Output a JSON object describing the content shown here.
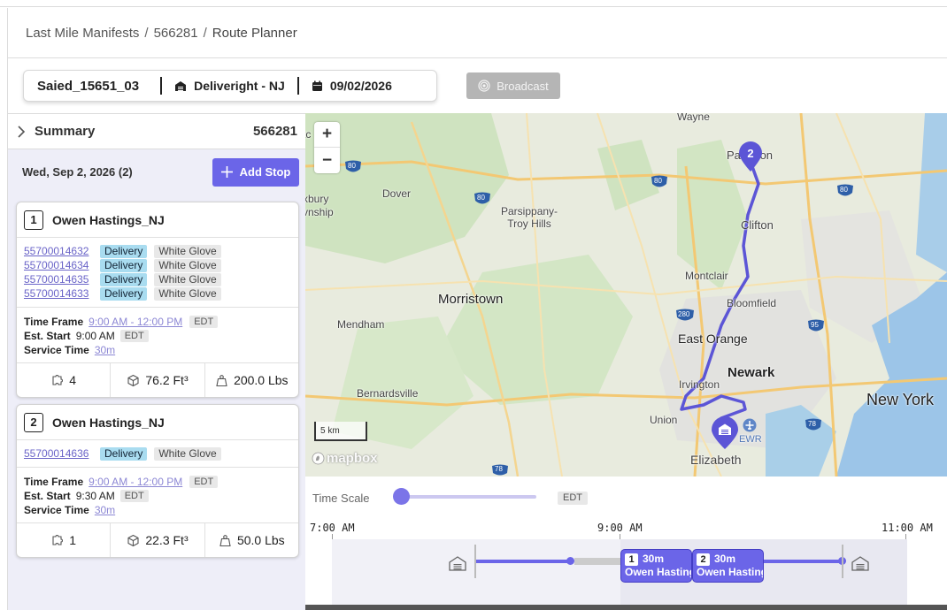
{
  "breadcrumb": {
    "items": [
      "Last Mile Manifests",
      "566281"
    ],
    "separator": "/",
    "current": "Route Planner"
  },
  "route_bar": {
    "route_name": "Saied_15651_03",
    "depot": "Deliveright - NJ",
    "date": "09/02/2026"
  },
  "broadcast_label": "Broadcast",
  "summary": {
    "label": "Summary",
    "value": "566281"
  },
  "day": {
    "date_label": "Wed, Sep 2, 2026 (2)",
    "add_stop_label": "Add Stop"
  },
  "labels": {
    "time_frame": "Time Frame",
    "est_start": "Est. Start",
    "service_time": "Service Time",
    "edt": "EDT"
  },
  "stops": [
    {
      "number": "1",
      "name": "Owen Hastings_NJ",
      "orders": [
        {
          "id": "55700014632",
          "type": "Delivery",
          "service": "White Glove"
        },
        {
          "id": "55700014634",
          "type": "Delivery",
          "service": "White Glove"
        },
        {
          "id": "55700014635",
          "type": "Delivery",
          "service": "White Glove"
        },
        {
          "id": "55700014633",
          "type": "Delivery",
          "service": "White Glove"
        }
      ],
      "time_frame": "9:00 AM - 12:00 PM",
      "est_start": "9:00 AM",
      "service_time": "30m",
      "pieces": "4",
      "volume": "76.2 Ft³",
      "weight": "200.0 Lbs"
    },
    {
      "number": "2",
      "name": "Owen Hastings_NJ",
      "orders": [
        {
          "id": "55700014636",
          "type": "Delivery",
          "service": "White Glove"
        }
      ],
      "time_frame": "9:00 AM - 12:00 PM",
      "est_start": "9:30 AM",
      "service_time": "30m",
      "pieces": "1",
      "volume": "22.3 Ft³",
      "weight": "50.0 Lbs"
    }
  ],
  "map": {
    "zoom_in": "+",
    "zoom_out": "−",
    "scale": "5 km",
    "attribution": "mapbox",
    "marker_label": "2",
    "airport_label": "EWR",
    "places": {
      "wayne": "Wayne",
      "paterson": "Paterson",
      "dover": "Dover",
      "parsippany": "Parsippany-\nTroy Hills",
      "clifton": "Clifton",
      "montclair": "Montclair",
      "bloomfield": "Bloomfield",
      "morristown": "Morristown",
      "mendham": "Mendham",
      "east_orange": "East Orange",
      "irvington": "Irvington",
      "newark": "Newark",
      "bernardsville": "Bernardsville",
      "union": "Union",
      "elizabeth": "Elizabeth",
      "new_york": "New York",
      "kbury": "xbury",
      "township": "vnship",
      "edge_top": "tc"
    },
    "shields": [
      "80",
      "80",
      "80",
      "80",
      "280",
      "95",
      "78",
      "78"
    ],
    "route_color": "#5c55d6"
  },
  "timeline": {
    "time_scale_label": "Time Scale",
    "tz": "EDT",
    "ticks": [
      "7:00 AM",
      "9:00 AM",
      "11:00 AM"
    ],
    "blocks": [
      {
        "number": "1",
        "duration": "30m",
        "name": "Owen Hastings_NJ"
      },
      {
        "number": "2",
        "duration": "30m",
        "name": "Owen Hastings_NJ"
      }
    ]
  },
  "colors": {
    "accent": "#6b65e8",
    "delivery_tag": "#a9dcf0",
    "panel_bg": "#eeeef8"
  }
}
